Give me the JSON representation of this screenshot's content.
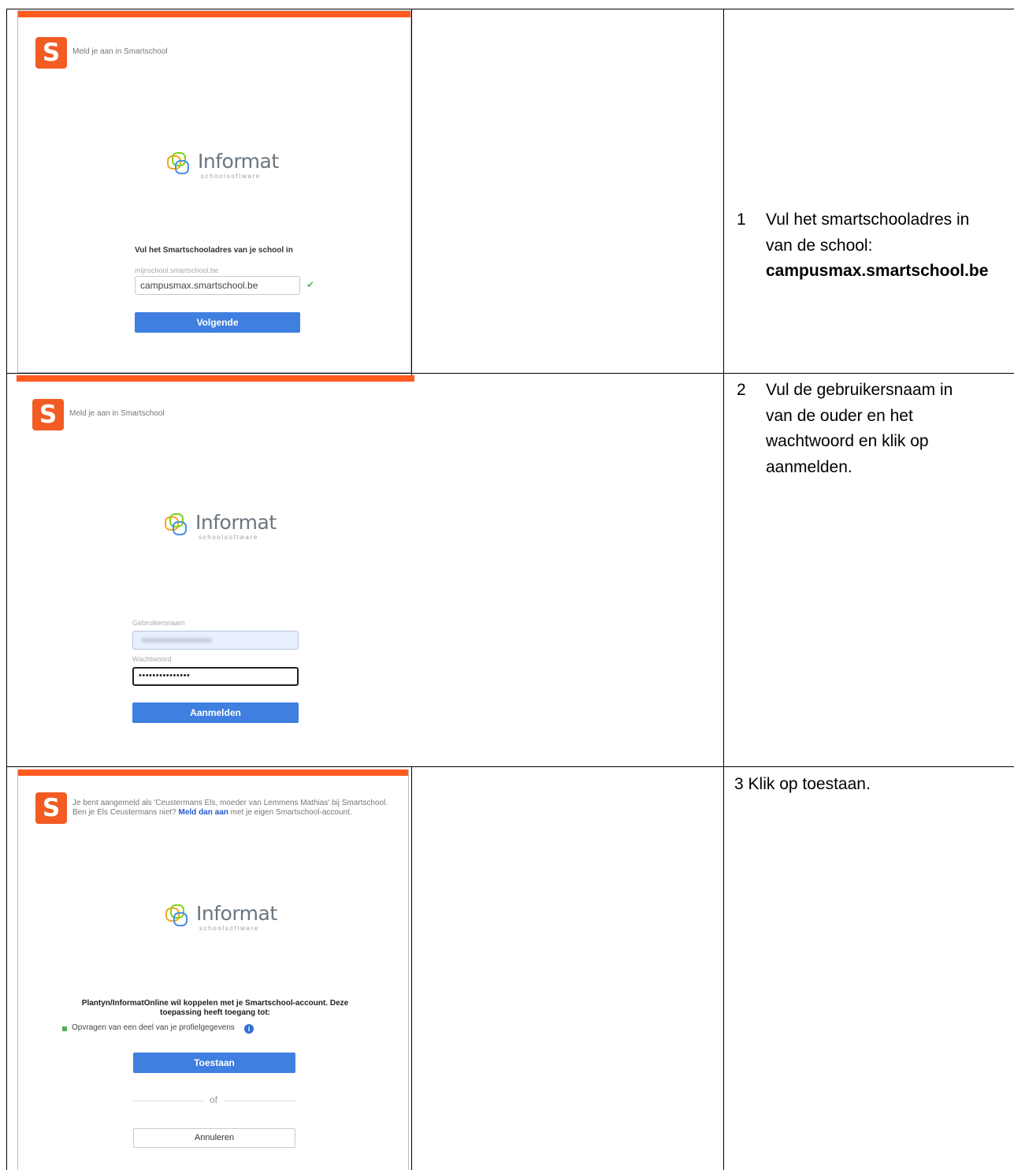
{
  "rows": [
    {
      "shot": {
        "header": "Meld je aan in Smartschool",
        "brand_name": "Informat",
        "brand_sub": "schoolsoftware",
        "form_title": "Vul het Smartschooladres van je school in",
        "field_placeholder": "mijnschool.smartschool.be",
        "field_value": "campusmax.smartschool.be",
        "button": "Volgende"
      },
      "step": {
        "number": "1",
        "text_line1": "Vul het smartschooladres in",
        "text_line2": "van de school:",
        "text_bold": "campusmax.smartschool.be"
      }
    },
    {
      "shot": {
        "header": "Meld je aan in Smartschool",
        "brand_name": "Informat",
        "brand_sub": "schoolsoftware",
        "username_label": "Gebruikersnaam",
        "password_label": "Wachtwoord",
        "password_value": "•••••••••••••••",
        "button": "Aanmelden"
      },
      "step": {
        "number": "2",
        "line1": "Vul de gebruikersnaam in",
        "line2": "van de ouder en het",
        "line3": "wachtwoord en klik op",
        "line4": "aanmelden."
      }
    },
    {
      "shot": {
        "header_line1": "Je bent aangemeld als 'Ceustermans Els, moeder van Lemmens Mathias' bij Smartschool.",
        "header_line2_pre": "Ben je Els Ceustermans niet?",
        "header_link": "Meld dan aan",
        "header_line2_post": "met je eigen Smartschool-account.",
        "brand_name": "Informat",
        "brand_sub": "schoolsoftware",
        "perm_title_line1": "Plantyn/InformatOnline wil koppelen met je Smartschool-account. Deze",
        "perm_title_line2": "toepassing heeft toegang tot:",
        "perm_item": "Opvragen van een deel van je profielgegevens",
        "button_allow": "Toestaan",
        "or_text": "of",
        "button_cancel": "Annuleren"
      },
      "step": {
        "number": "3",
        "text": "Klik op toestaan."
      }
    }
  ],
  "icons": {
    "logo": "smartschool-s-logo",
    "brand": "informat-rings-logo",
    "check": "check-icon",
    "info": "info-icon"
  },
  "colors": {
    "accent_orange": "#ff5a1f",
    "button_blue": "#3f7fe0",
    "check_green": "#5cb85c"
  }
}
